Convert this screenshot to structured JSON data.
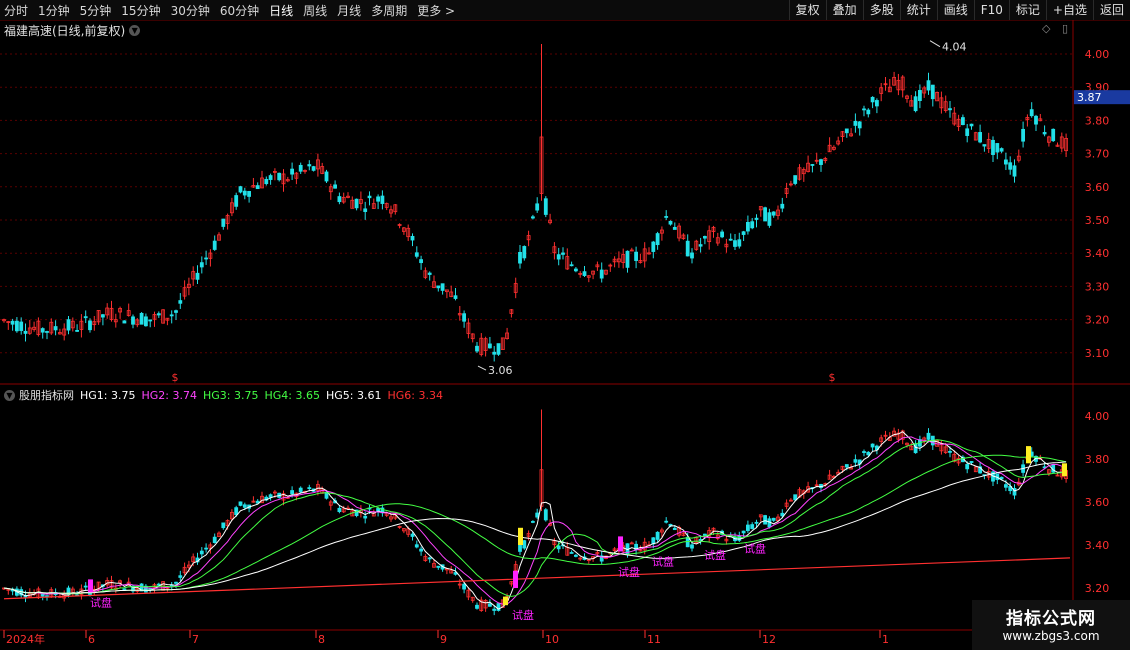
{
  "toolbar": {
    "periods": [
      "分时",
      "1分钟",
      "5分钟",
      "15分钟",
      "30分钟",
      "60分钟",
      "日线",
      "周线",
      "月线",
      "多周期",
      "更多 >"
    ],
    "active_period": "日线",
    "buttons": [
      "复权",
      "叠加",
      "多股",
      "统计",
      "画线",
      "F10",
      "标记",
      "+自选",
      "返回"
    ]
  },
  "main_chart": {
    "title": "福建高速(日线,前复权)",
    "last_price_badge": "3.87",
    "y_axis_labels": [
      "4.00",
      "3.90",
      "3.80",
      "3.70",
      "3.60",
      "3.50",
      "3.40",
      "3.30",
      "3.20",
      "3.10"
    ],
    "high_marker": "4.04",
    "low_marker": "3.06",
    "event_marker": "$"
  },
  "indicator": {
    "name": "股朋指标网",
    "values": [
      {
        "label": "HG1: 3.75",
        "color": "#ffffff"
      },
      {
        "label": "HG2: 3.74",
        "color": "#ff44ff"
      },
      {
        "label": "HG3: 3.75",
        "color": "#44ff44"
      },
      {
        "label": "HG4: 3.65",
        "color": "#44ff44"
      },
      {
        "label": "HG5: 3.61",
        "color": "#ffffff"
      },
      {
        "label": "HG6: 3.34",
        "color": "#ff3030"
      }
    ],
    "y_axis_labels": [
      "4.00",
      "3.80",
      "3.60",
      "3.40",
      "3.20"
    ],
    "signal_label": "试盘"
  },
  "x_axis_labels": [
    "2024年",
    "6",
    "7",
    "8",
    "9",
    "10",
    "11",
    "12",
    "1"
  ],
  "watermark": {
    "title": "指标公式网",
    "url": "www.zbgs3.com"
  },
  "colors": {
    "up": "#ff3030",
    "down": "#22e0e8",
    "grid": "#5a0000",
    "axis_text": "#ff3030",
    "badge_bg": "#1a3aa0",
    "signal_yellow": "#ffee22",
    "signal_magenta": "#ff22ff"
  }
}
